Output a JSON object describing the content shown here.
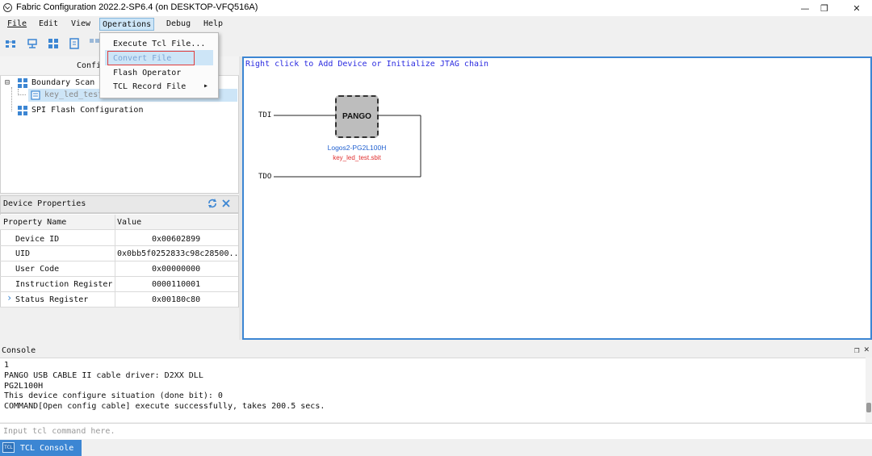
{
  "window": {
    "title": "Fabric Configuration 2022.2-SP6.4 (on DESKTOP-VFQ516A)",
    "minimize": "—",
    "maximize": "❐",
    "close": "✕"
  },
  "menu": {
    "items": [
      "File",
      "Edit",
      "View",
      "Operations",
      "Debug",
      "Help"
    ],
    "active": "Operations"
  },
  "dropdown": {
    "items": [
      "Execute Tcl File...",
      "Convert File",
      "Flash Operator",
      "TCL Record File"
    ],
    "highlighted": "Convert File",
    "submenu_arrow": "▸"
  },
  "tree": {
    "header": "Confi",
    "items": [
      {
        "label": "Boundary Scan",
        "icon": "grid-icon"
      },
      {
        "label": "key_led_test.sbit",
        "icon": "file-icon"
      },
      {
        "label": "SPI Flash Configuration",
        "icon": "grid-icon"
      }
    ],
    "collapse_symbol": "⊟"
  },
  "properties": {
    "title": "Device Properties",
    "columns": [
      "Property Name",
      "Value"
    ],
    "rows": [
      {
        "name": "Device ID",
        "value": "0x00602899"
      },
      {
        "name": "UID",
        "value": "0x0bb5f0252833c98c28500..."
      },
      {
        "name": "User Code",
        "value": "0x00000000"
      },
      {
        "name": "Instruction Register",
        "value": "0000110001"
      },
      {
        "name": "Status Register",
        "value": "0x00180c80"
      }
    ],
    "expand_symbol": "›"
  },
  "canvas": {
    "hint": "Right click to Add Device or Initialize JTAG chain",
    "chip_label": "PANGO",
    "device_name": "Logos2-PG2L100H",
    "device_file": "key_led_test.sbit",
    "tdi": "TDI",
    "tdo": "TDO"
  },
  "console": {
    "title": "Console",
    "lines": [
      "1",
      "PANGO USB CABLE II cable driver: D2XX DLL",
      "PG2L100H",
      "This device configure situation (done bit): 0",
      "COMMAND[Open config cable] execute successfully, takes 200.5 secs."
    ],
    "input_placeholder": "Input tcl command here.",
    "tab_label": "TCL Console",
    "tab_icon_text": "TCL"
  },
  "colors": {
    "accent": "#3c86d3",
    "highlight_border": "#e03c3c",
    "device_name": "#2060d0",
    "device_file": "#e03030",
    "hint_text": "#2a2ae0"
  }
}
